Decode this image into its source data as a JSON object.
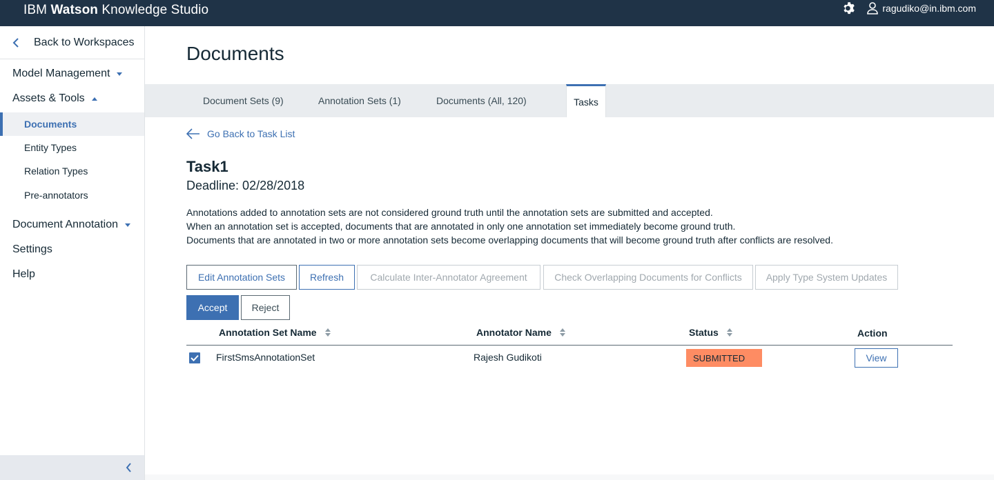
{
  "app": {
    "brand_ibm": "IBM",
    "brand_watson": "Watson",
    "brand_rest": "Knowledge Studio",
    "user_email": "ragudiko@in.ibm.com"
  },
  "sidebar": {
    "back_label": "Back to Workspaces",
    "model_management": "Model Management",
    "assets_tools": "Assets & Tools",
    "sub_items": [
      "Documents",
      "Entity Types",
      "Relation Types",
      "Pre-annotators"
    ],
    "document_annotation": "Document Annotation",
    "settings": "Settings",
    "help": "Help"
  },
  "main": {
    "title": "Documents",
    "tabs": [
      "Document Sets (9)",
      "Annotation Sets (1)",
      "Documents (All, 120)",
      "Tasks"
    ],
    "go_back": "Go Back to Task List",
    "task_name": "Task1",
    "deadline": "Deadline: 02/28/2018",
    "description": [
      "Annotations added to annotation sets are not considered ground truth until the annotation sets are submitted and accepted.",
      "When an annotation set is accepted, documents that are annotated in only one annotation set immediately become ground truth.",
      "Documents that are annotated in two or more annotation sets become overlapping documents that will become ground truth after conflicts are resolved."
    ],
    "buttons": {
      "edit_sets": "Edit Annotation Sets",
      "refresh": "Refresh",
      "calc_iaa": "Calculate Inter-Annotator Agreement",
      "check_overlap": "Check Overlapping Documents for Conflicts",
      "apply_type": "Apply Type System Updates",
      "accept": "Accept",
      "reject": "Reject"
    },
    "table": {
      "headers": [
        "Annotation Set Name",
        "Annotator Name",
        "Status",
        "Action"
      ],
      "rows": [
        {
          "checked": true,
          "set_name": "FirstSmsAnnotationSet",
          "annotator": "Rajesh Gudikoti",
          "status": "SUBMITTED",
          "action": "View"
        }
      ]
    }
  },
  "colors": {
    "topbar": "#1f3347",
    "accent": "#3d70b2",
    "status_submitted": "#fe8c63"
  }
}
